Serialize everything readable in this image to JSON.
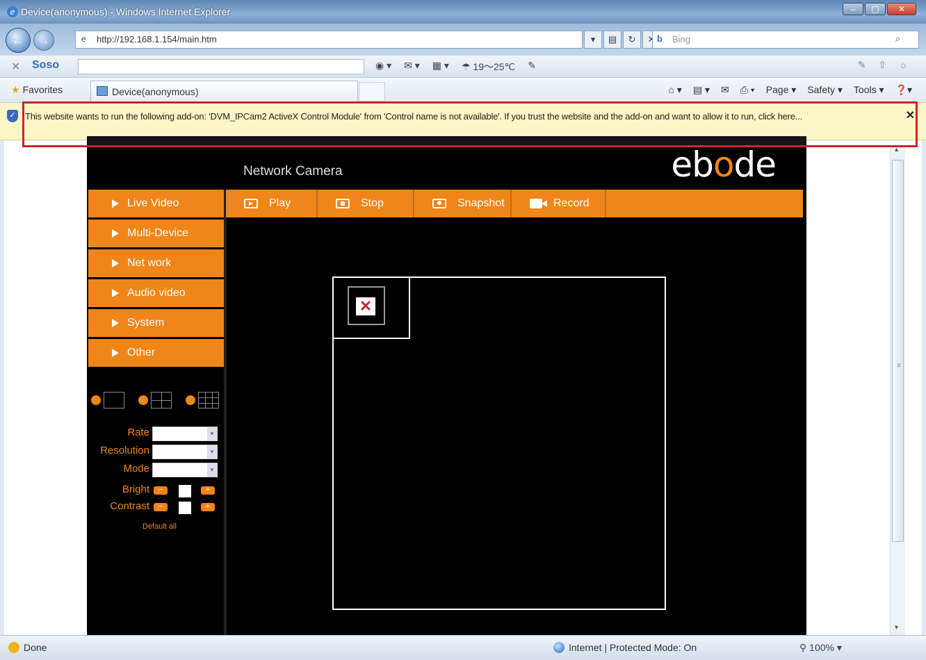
{
  "window": {
    "title": "Device(anonymous) - Windows Internet Explorer",
    "controls": [
      "–",
      "▢",
      "✕"
    ]
  },
  "address": {
    "url": "http://192.168.1.154/main.htm",
    "search_placeholder": "Bing"
  },
  "toolbar": {
    "search_engine": "Soso",
    "weather": "19～25℃"
  },
  "favorites": {
    "label": "Favorites",
    "tab_title": "Device(anonymous)",
    "commands": [
      "Page ▾",
      "Safety ▾",
      "Tools ▾"
    ]
  },
  "infobar": {
    "message": "This website wants to run the following add-on: 'DVM_IPCam2 ActiveX Control Module' from 'Control name is not available'. If you trust the website and the add-on and want to allow it to run, click here...",
    "close": "✕"
  },
  "camera": {
    "page_title": "Network Camera",
    "logo_prefix": "eb",
    "logo_o": "o",
    "logo_suffix": "de",
    "menu": [
      "Live Video",
      "Multi-Device",
      "Net work",
      "Audio video",
      "System",
      "Other"
    ],
    "actions": [
      "Play",
      "Stop",
      "Snapshot",
      "Record"
    ],
    "controls": {
      "rate_label": "Rate",
      "resolution_label": "Resolution",
      "mode_label": "Mode",
      "bright_label": "Bright",
      "contrast_label": "Contrast",
      "default_all": "Default all"
    }
  },
  "status": {
    "left": "Done",
    "zone": "Internet | Protected Mode: On",
    "zoom": "100%"
  }
}
